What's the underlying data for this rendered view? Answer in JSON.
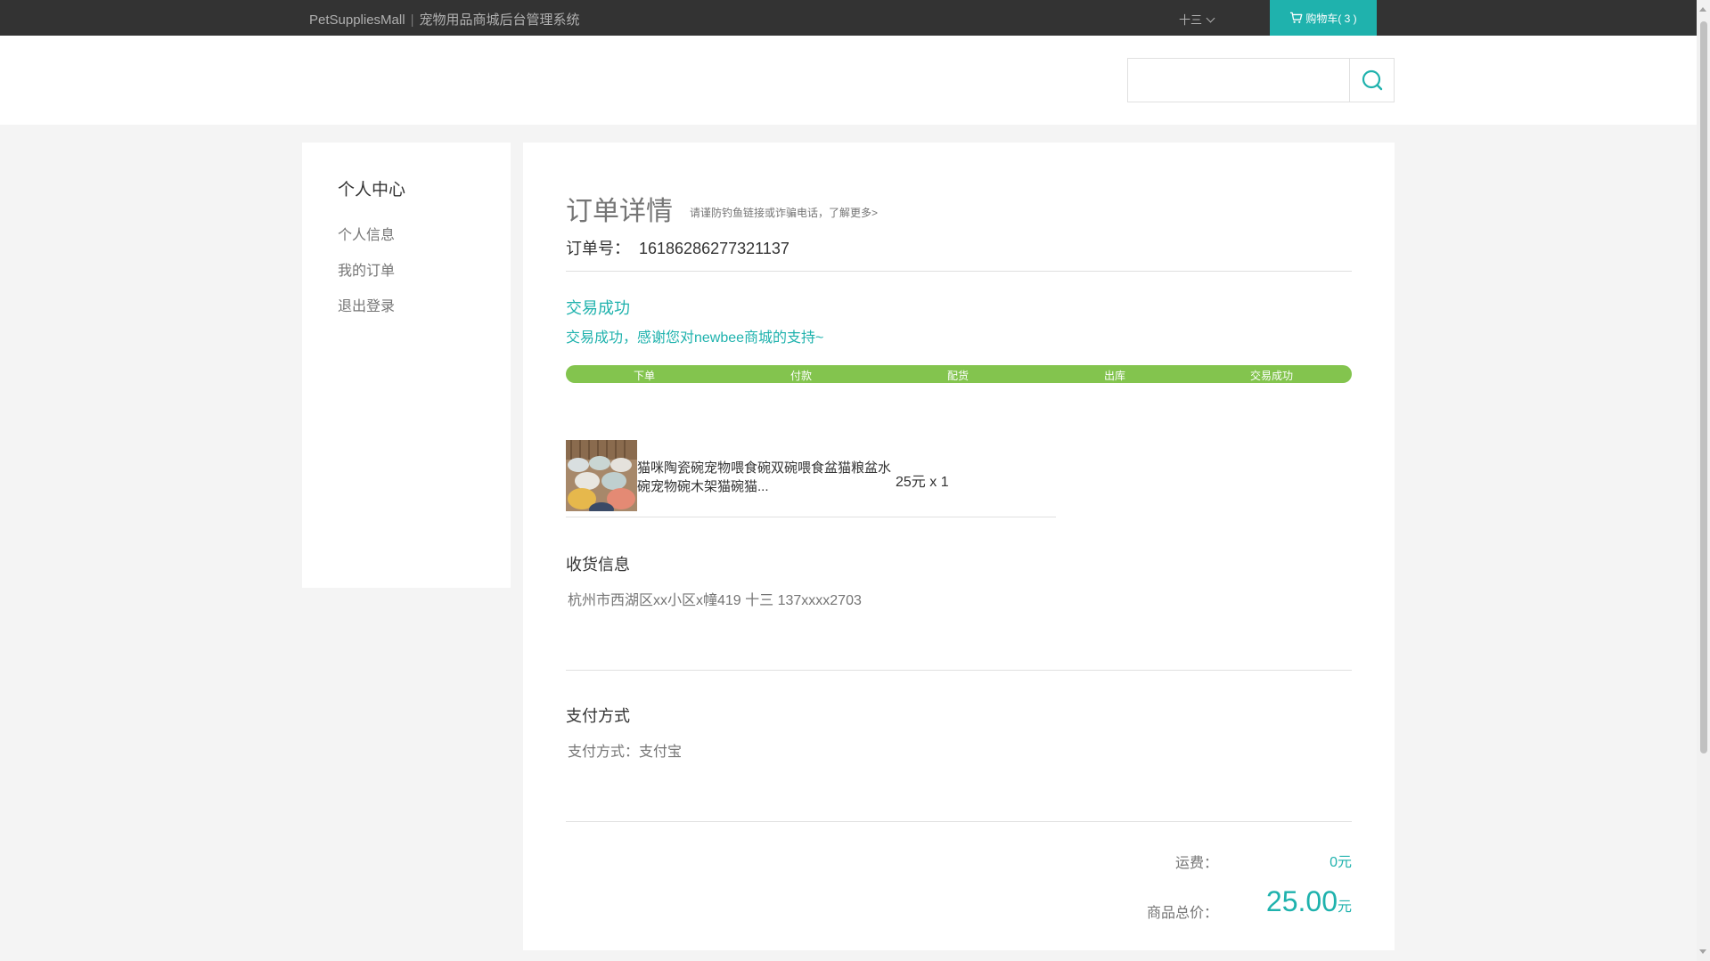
{
  "topbar": {
    "brand": "PetSuppliesMall",
    "separator": "|",
    "system_name": "宠物用品商城后台管理系统",
    "username": "十三",
    "cart_label": "购物车( 3 )"
  },
  "search": {
    "value": "",
    "placeholder": ""
  },
  "sidebar": {
    "title": "个人中心",
    "items": [
      {
        "label": "个人信息"
      },
      {
        "label": "我的订单"
      },
      {
        "label": "退出登录"
      }
    ]
  },
  "order": {
    "title": "订单详情",
    "tip": "请谨防钓鱼链接或诈骗电话，了解更多>",
    "number_label": "订单号：",
    "number": "16186286277321137",
    "status_title": "交易成功",
    "status_message": "交易成功，感谢您对newbee商城的支持~",
    "steps": [
      "下单",
      "付款",
      "配货",
      "出库",
      "交易成功"
    ],
    "progress_fraction": 1.0,
    "item": {
      "name": "猫咪陶瓷碗宠物喂食碗双碗喂食盆猫粮盆水碗宠物碗木架猫碗猫...",
      "price_qty": "25元 x 1"
    },
    "shipping": {
      "title": "收货信息",
      "address": "杭州市西湖区xx小区x幢419 十三 137xxxx2703"
    },
    "payment": {
      "title": "支付方式",
      "label": "支付方式：",
      "value": "支付宝"
    },
    "freight_label": "运费：",
    "freight_value": "0",
    "freight_unit": "元",
    "total_label": "商品总价：",
    "total_value": "25.00",
    "total_unit": "元"
  },
  "colors": {
    "accent": "#1fb2ad",
    "progress": "#83c44e",
    "topbar": "#333333"
  },
  "icons": [
    "cart-icon",
    "search-icon",
    "chevron-down-icon"
  ]
}
